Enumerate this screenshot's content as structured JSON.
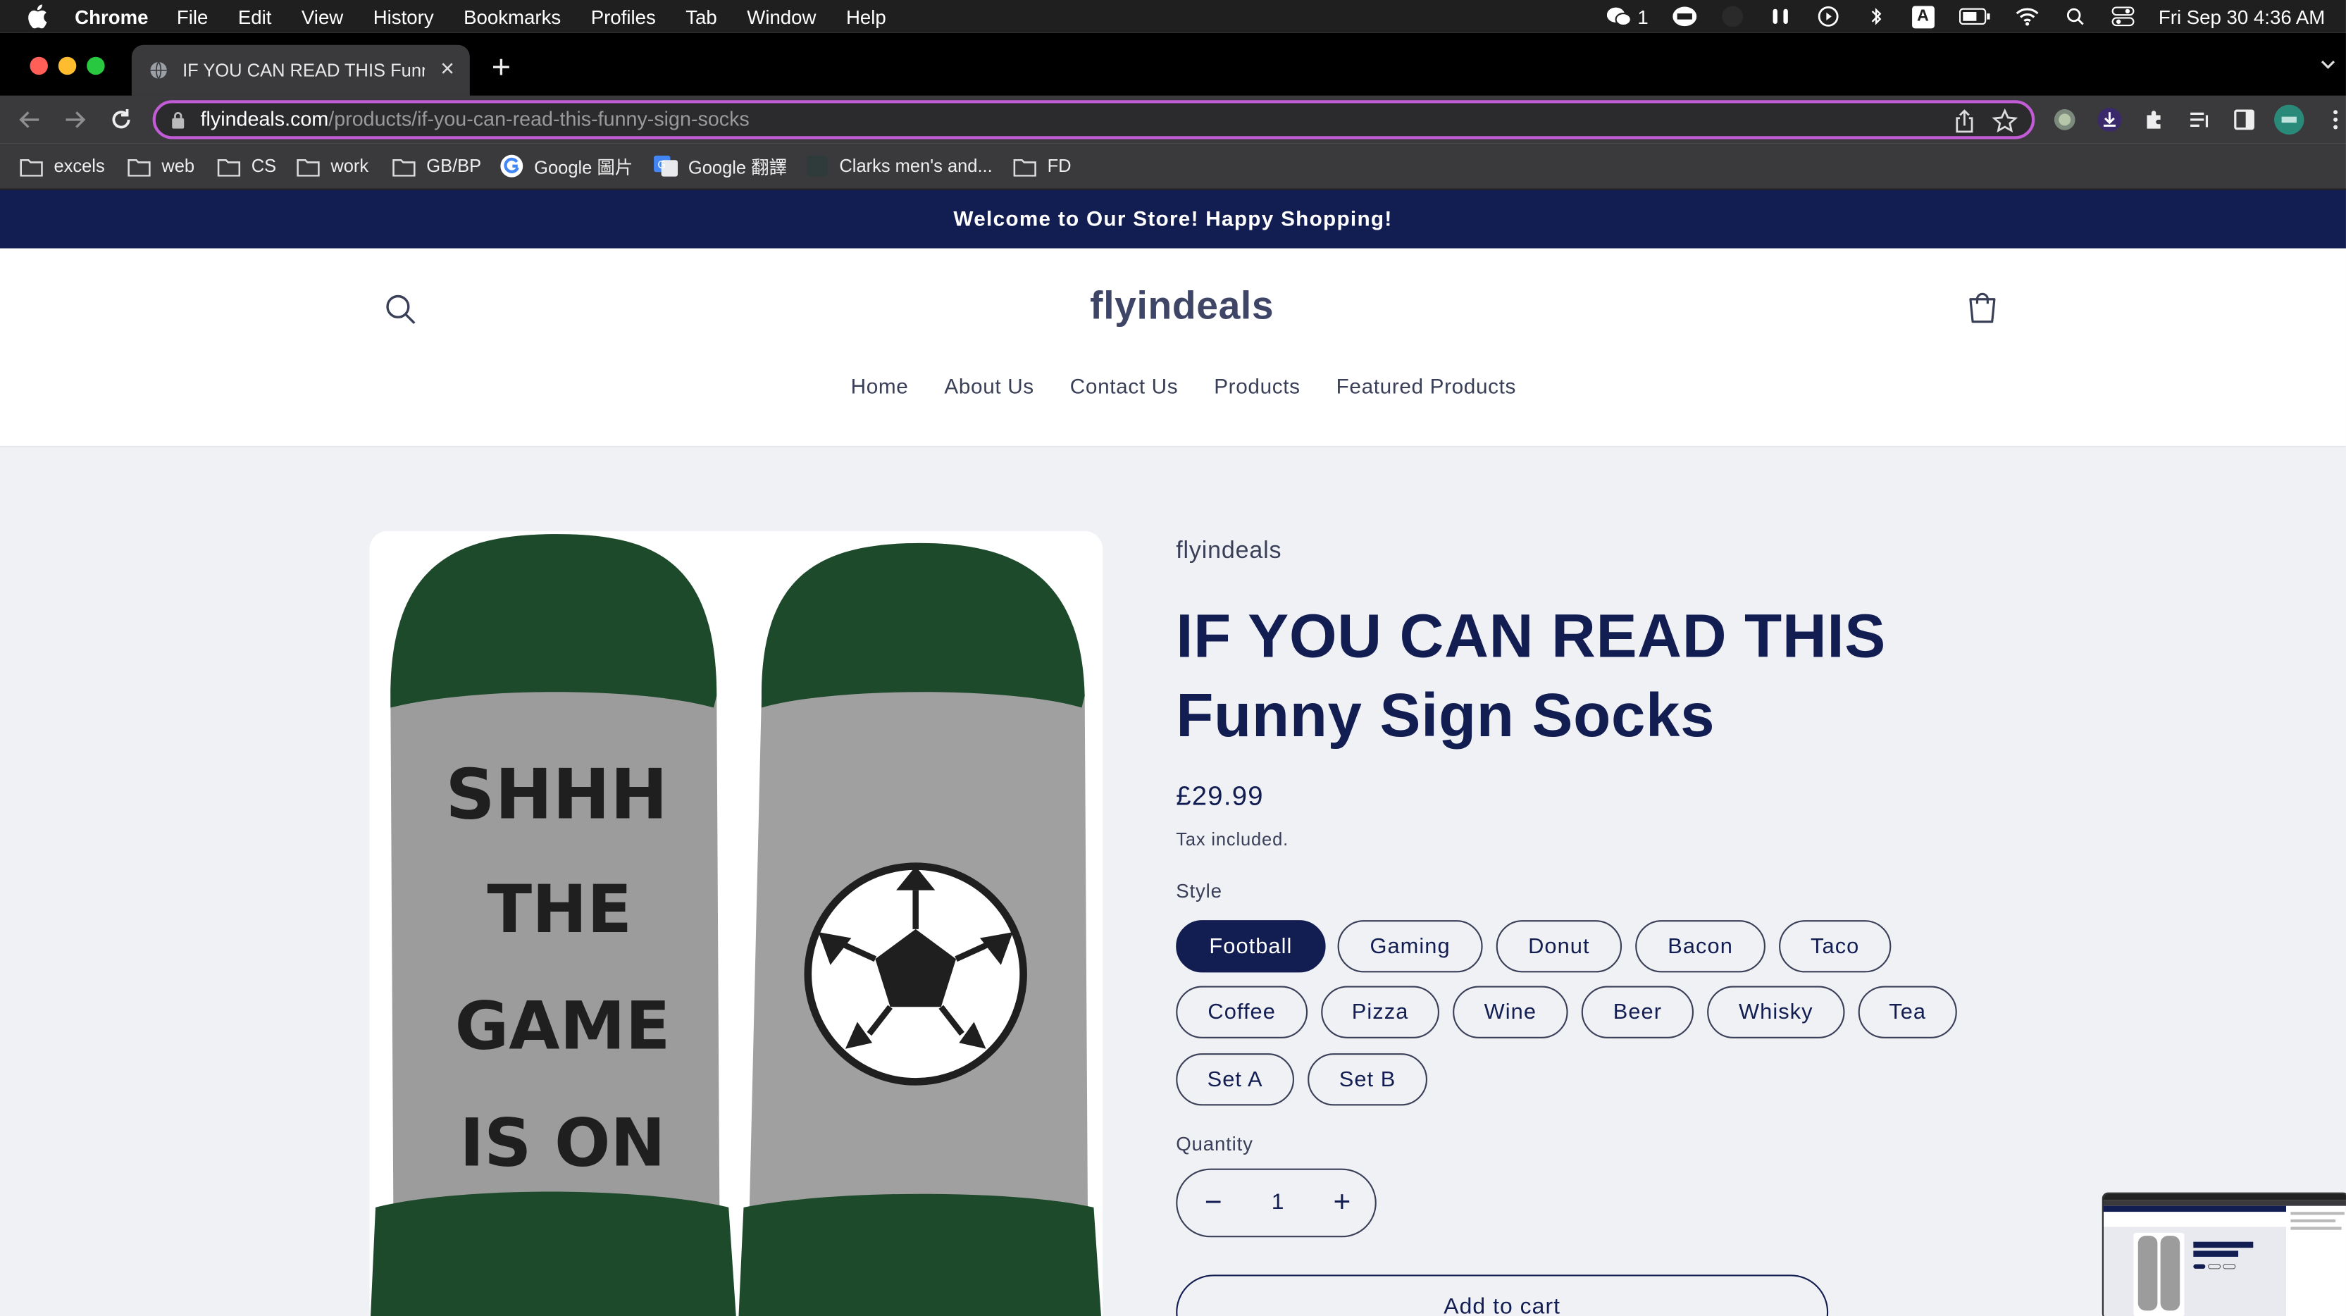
{
  "menubar": {
    "app": "Chrome",
    "items": [
      "File",
      "Edit",
      "View",
      "History",
      "Bookmarks",
      "Profiles",
      "Tab",
      "Window",
      "Help"
    ],
    "wechat_count": "1",
    "input_source": "A",
    "datetime": "Fri Sep 30  4:36 AM"
  },
  "tab": {
    "title": "IF YOU CAN READ THIS Funny Sign Socks",
    "close": "×",
    "new": "+"
  },
  "omnibox": {
    "host": "flyindeals.com",
    "path": "/products/if-you-can-read-this-funny-sign-socks"
  },
  "bookmarks": [
    "excels",
    "web",
    "CS",
    "work",
    "GB/BP",
    "Google 圖片",
    "Google 翻譯",
    "Clarks men's and...",
    "FD"
  ],
  "announcement": "Welcome to Our Store! Happy Shopping!",
  "header": {
    "logo": "flyindeals",
    "nav": [
      "Home",
      "About Us",
      "Contact Us",
      "Products",
      "Featured Products"
    ]
  },
  "product": {
    "vendor": "flyindeals",
    "title": "IF YOU CAN READ THIS Funny Sign Socks",
    "price": "£29.99",
    "tax_note": "Tax included.",
    "style_label": "Style",
    "styles": [
      "Football",
      "Gaming",
      "Donut",
      "Bacon",
      "Taco",
      "Coffee",
      "Pizza",
      "Wine",
      "Beer",
      "Whisky",
      "Tea",
      "Set A",
      "Set B"
    ],
    "selected_style": "Football",
    "quantity_label": "Quantity",
    "quantity": "1",
    "minus": "−",
    "plus": "+",
    "add_to_cart": "Add to cart",
    "sock_text": [
      "SHHH",
      "THE",
      "GAME",
      "IS ON"
    ]
  },
  "colors": {
    "brand_navy": "#121d52",
    "omnibox_border": "#c15bd6",
    "sock_green": "#1d4a2c",
    "sock_grey": "#9a9a9a"
  }
}
